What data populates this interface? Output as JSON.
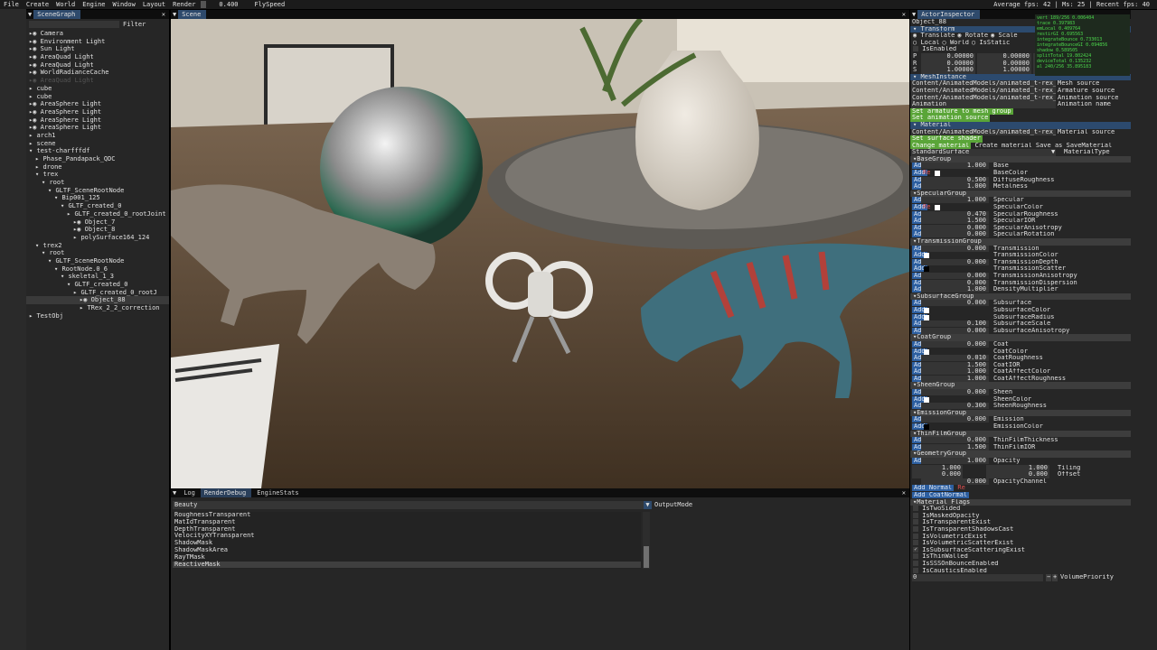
{
  "menubar": {
    "items": [
      "File",
      "Create",
      "World",
      "Engine",
      "Window",
      "Layout",
      "Render"
    ],
    "value": "0.400",
    "flyspeed_label": "FlySpeed",
    "fps": "Average fps: 42 | Ms: 25 | Recent fps: 40"
  },
  "scenegraph": {
    "title": "SceneGraph",
    "filter_label": "Filter",
    "items": [
      "Camera",
      "Environment Light",
      "Sun Light",
      "AreaQuad Light",
      "AreaQuad Light",
      "WorldRadianceCache",
      "AreaQuad Light",
      "cube",
      "cube",
      "AreaSphere Light",
      "AreaSphere Light",
      "AreaSphere Light",
      "AreaSphere Light",
      "arch1",
      "scene",
      "test-charfffdf",
      "Phase_Pandapack_QDC",
      "drone",
      "trex",
      "root",
      "GLTF_SceneRootNode",
      "Bip001_125",
      "GLTF_created_0",
      "GLTF_created_0_rootJoint",
      "Object_7",
      "Object_8",
      "polySurface164_124",
      "trex2",
      "root",
      "GLTF_SceneRootNode",
      "RootNode.0_6",
      "skeletal_1_3",
      "GLTF_created_0",
      "GLTF_created_0_rootJ",
      "Object_88",
      "TRex_2_2_correction",
      "TestObj"
    ]
  },
  "scene": {
    "title": "Scene"
  },
  "bottom": {
    "tabs": [
      "Log",
      "RenderDebug",
      "EngineStats"
    ],
    "select_value": "Beauty",
    "output_label": "OutputMode",
    "list": [
      "RoughnessTransparent",
      "MatIdTransparent",
      "DepthTransparent",
      "VelocityXYTransparent",
      "ShadowMask",
      "ShadowMaskArea",
      "RayTMask",
      "ReactiveMask"
    ]
  },
  "inspector": {
    "title": "ActorInspector",
    "object_name": "Object_88",
    "transform": {
      "header": "Transform",
      "modes": [
        "Translate",
        "Rotate",
        "Scale"
      ],
      "spaces": [
        "Local",
        "World",
        "IsStatic"
      ],
      "enabled": "IsEnabled",
      "rows": [
        [
          "P",
          "0.00000",
          "0.00000",
          "0.0"
        ],
        [
          "R",
          "0.00000",
          "0.00000",
          "0.0"
        ],
        [
          "S",
          "1.00000",
          "1.00000",
          "1.0"
        ]
      ]
    },
    "mesh": {
      "header": "MeshInstance",
      "rows": [
        [
          "Content/AnimatedModels/animated_t-rex_dinosau",
          "Mesh source"
        ],
        [
          "Content/AnimatedModels/animated_t-rex_dinosau",
          "Armature source"
        ],
        [
          "Content/AnimatedModels/animated_t-rex_dinosau",
          "Animation source"
        ],
        [
          "Animation",
          "Animation name"
        ]
      ],
      "btn1": "Set armature to mesh group",
      "btn2": "Set animation source"
    },
    "material": {
      "header": "Material",
      "source_path": "Content/AnimatedModels/animated_t-rex_dinosau",
      "source_label": "Material source",
      "set_shader": "Set surface shader",
      "change": "Change material",
      "create": "Create material",
      "save_as": "Save as",
      "save": "SaveMaterial",
      "type_value": "StandardSurface",
      "type_label": "MaterialType"
    },
    "groups": [
      {
        "name": "BaseGroup",
        "rows": [
          [
            "1.000",
            "Base"
          ],
          [
            "color",
            "BaseColor"
          ],
          [
            "0.500",
            "DiffuseRoughness"
          ],
          [
            "1.000",
            "Metalness"
          ]
        ]
      },
      {
        "name": "SpecularGroup",
        "rows": [
          [
            "1.000",
            "Specular"
          ],
          [
            "color",
            "SpecularColor"
          ],
          [
            "0.470",
            "SpecularRoughness"
          ],
          [
            "1.500",
            "SpecularIOR"
          ],
          [
            "0.000",
            "SpecularAnisotropy"
          ],
          [
            "0.000",
            "SpecularRotation"
          ]
        ]
      },
      {
        "name": "TransmissionGroup",
        "rows": [
          [
            "0.000",
            "Transmission"
          ],
          [
            "white",
            "TransmissionColor"
          ],
          [
            "0.000",
            "TransmissionDepth"
          ],
          [
            "black",
            "TransmissionScatter"
          ],
          [
            "0.000",
            "TransmissionAnisotropy"
          ],
          [
            "0.000",
            "TransmissionDispersion"
          ],
          [
            "1.000",
            "DensityMultiplier"
          ]
        ]
      },
      {
        "name": "SubsurfaceGroup",
        "rows": [
          [
            "0.000",
            "Subsurface"
          ],
          [
            "white",
            "SubsurfaceColor"
          ],
          [
            "white",
            "SubsurfaceRadius"
          ],
          [
            "0.100",
            "SubsurfaceScale"
          ],
          [
            "0.000",
            "SubsurfaceAnisotropy"
          ]
        ]
      },
      {
        "name": "CoatGroup",
        "rows": [
          [
            "0.000",
            "Coat"
          ],
          [
            "white",
            "CoatColor"
          ],
          [
            "0.010",
            "CoatRoughness"
          ],
          [
            "1.500",
            "CoatIOR"
          ],
          [
            "1.000",
            "CoatAffectColor"
          ],
          [
            "1.000",
            "CoatAffectRoughness"
          ]
        ]
      },
      {
        "name": "SheenGroup",
        "rows": [
          [
            "0.000",
            "Sheen"
          ],
          [
            "white",
            "SheenColor"
          ],
          [
            "0.300",
            "SheenRoughness"
          ]
        ]
      },
      {
        "name": "EmissionGroup",
        "rows": [
          [
            "0.000",
            "Emission"
          ],
          [
            "black",
            "EmissionColor"
          ]
        ]
      },
      {
        "name": "ThinFilmGroup",
        "rows": [
          [
            "0.000",
            "ThinFilmThickness"
          ],
          [
            "1.500",
            "ThinFilmIOR"
          ]
        ]
      },
      {
        "name": "GeometryGroup",
        "rows": [
          [
            "1.000",
            "Opacity"
          ]
        ]
      }
    ],
    "geometry_extra": [
      [
        "1.000",
        "1.000",
        "Tiling"
      ],
      [
        "0.000",
        "0.000",
        "Offset"
      ],
      [
        "0.000",
        "OpacityChannel"
      ]
    ],
    "add_normal": "Add Normal",
    "add_coat_normal": "Add CoatNormal",
    "flags_header": "Material Flags",
    "flags": [
      "IsTwoSided",
      "IsMaskedOpacity",
      "IsTransparentExist",
      "IsTransparentShadowsCast",
      "IsVolumetricExist",
      "IsVolumetricScatterExist",
      "IsSubsurfaceScatteringExist",
      "IsThinWalled",
      "IsSSSOnBounceEnabled",
      "IsCausticsEnabled"
    ],
    "flag_checked_index": 6,
    "volume_value": "0",
    "volume_label": "VolumePriority"
  },
  "stats": [
    "vert 189/256 0.006404",
    "trace 0.397983",
    "emLocal 0.409764",
    "restirGI 0.695563",
    "integrateBounce 0.733013",
    "integrateBounceGI 0.094856",
    "shadow 0.589505",
    "splitTotal 19.802424",
    "deviceTotal 0.135232",
    "al 240/256 35.895183"
  ]
}
